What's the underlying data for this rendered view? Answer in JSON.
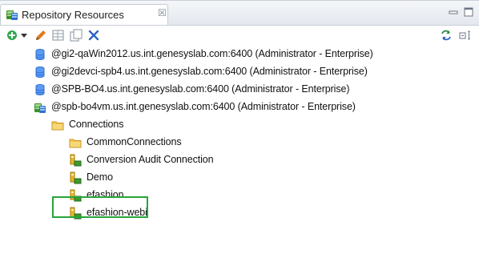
{
  "view": {
    "tab_title": "Repository Resources",
    "tab_close_glyph": "☒",
    "tab_icon": "repository-icon",
    "minimize_icon": "minimize-icon",
    "maximize_icon": "maximize-icon"
  },
  "toolbar": {
    "buttons": [
      {
        "name": "add-button",
        "icon": "green-plus-icon"
      },
      {
        "name": "dropdown-arrow",
        "icon": "chevron-down-icon"
      },
      {
        "name": "edit-button",
        "icon": "pencil-icon"
      },
      {
        "name": "properties-button",
        "icon": "table-icon"
      },
      {
        "name": "copy-button",
        "icon": "copy-icon"
      },
      {
        "name": "delete-button",
        "icon": "close-icon"
      },
      {
        "name": "refresh-button",
        "icon": "refresh-icon"
      },
      {
        "name": "collapse-button",
        "icon": "collapse-icon"
      }
    ]
  },
  "tree": {
    "servers": [
      {
        "label": "@gi2-qaWin2012.us.int.genesyslab.com:6400 (Administrator - Enterprise)",
        "icon": "database-icon"
      },
      {
        "label": "@gi2devci-spb4.us.int.genesyslab.com:6400 (Administrator - Enterprise)",
        "icon": "database-icon"
      },
      {
        "label": "@SPB-BO4.us.int.genesyslab.com:6400 (Administrator - Enterprise)",
        "icon": "database-icon"
      },
      {
        "label": "@spb-bo4vm.us.int.genesyslab.com:6400 (Administrator - Enterprise)",
        "icon": "repository-connected-icon"
      }
    ],
    "connections_folder": {
      "label": "Connections",
      "icon": "folder-icon"
    },
    "children": [
      {
        "label": "CommonConnections",
        "icon": "folder-icon"
      },
      {
        "label": "Conversion Audit Connection",
        "icon": "connection-icon"
      },
      {
        "label": "Demo",
        "icon": "connection-icon"
      },
      {
        "label": "efashion",
        "icon": "connection-icon"
      },
      {
        "label": "efashion-webi",
        "icon": "connection-icon"
      }
    ]
  },
  "colors": {
    "highlight": "#27a53b",
    "db_blue": "#2e6fd6",
    "folder": "#e8b93a",
    "connection_yellow": "#e9b623",
    "connection_green": "#3c9a2d"
  }
}
